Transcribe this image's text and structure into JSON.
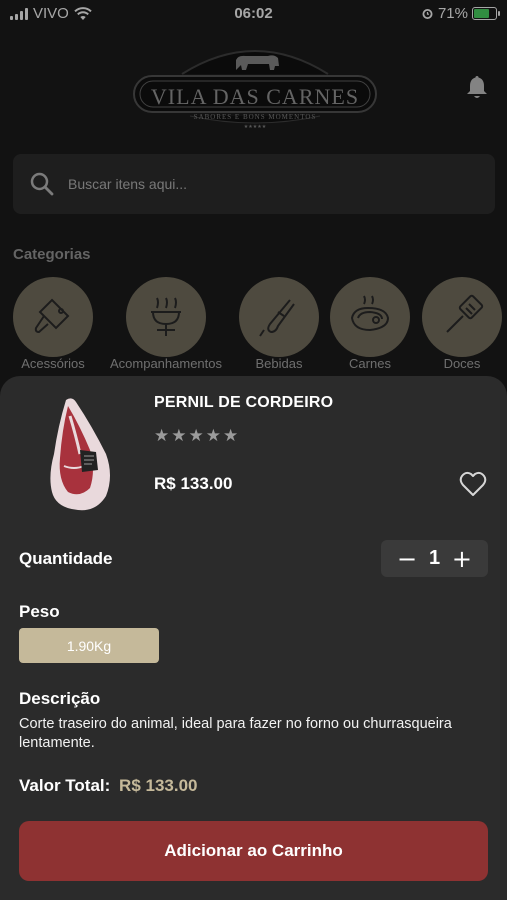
{
  "status_bar": {
    "carrier": "VIVO",
    "time": "06:02",
    "battery": "71%"
  },
  "header": {
    "logo_text": "VILA DAS CARNES",
    "logo_tagline": "SABORES E BONS MOMENTOS"
  },
  "search": {
    "placeholder": "Buscar itens aqui..."
  },
  "categories": {
    "title": "Categorias",
    "items": [
      {
        "label": "Acessórios",
        "icon": "cleaver-icon"
      },
      {
        "label": "Acompanhamentos",
        "icon": "sausage-grill-icon"
      },
      {
        "label": "Bebidas",
        "icon": "tongs-icon"
      },
      {
        "label": "Carnes",
        "icon": "steak-icon"
      },
      {
        "label": "Doces",
        "icon": "spatula-icon"
      }
    ]
  },
  "product": {
    "name": "PERNIL DE CORDEIRO",
    "rating": 0,
    "rating_max": 5,
    "price": "R$ 133.00",
    "quantity_label": "Quantidade",
    "quantity": "1",
    "minus": "−",
    "plus": "+",
    "weight_label": "Peso",
    "weight_option": "1.90Kg",
    "description_label": "Descrição",
    "description": "Corte traseiro do animal, ideal para fazer no forno ou churrasqueira lentamente.",
    "total_label": "Valor Total:",
    "total_value": "R$ 133.00",
    "cta_label": "Adicionar ao Carrinho"
  },
  "colors": {
    "background": "#1c1c1c",
    "sheet": "#2b2b2b",
    "accent_gold": "#c5b99a",
    "cta": "#8e3232"
  }
}
